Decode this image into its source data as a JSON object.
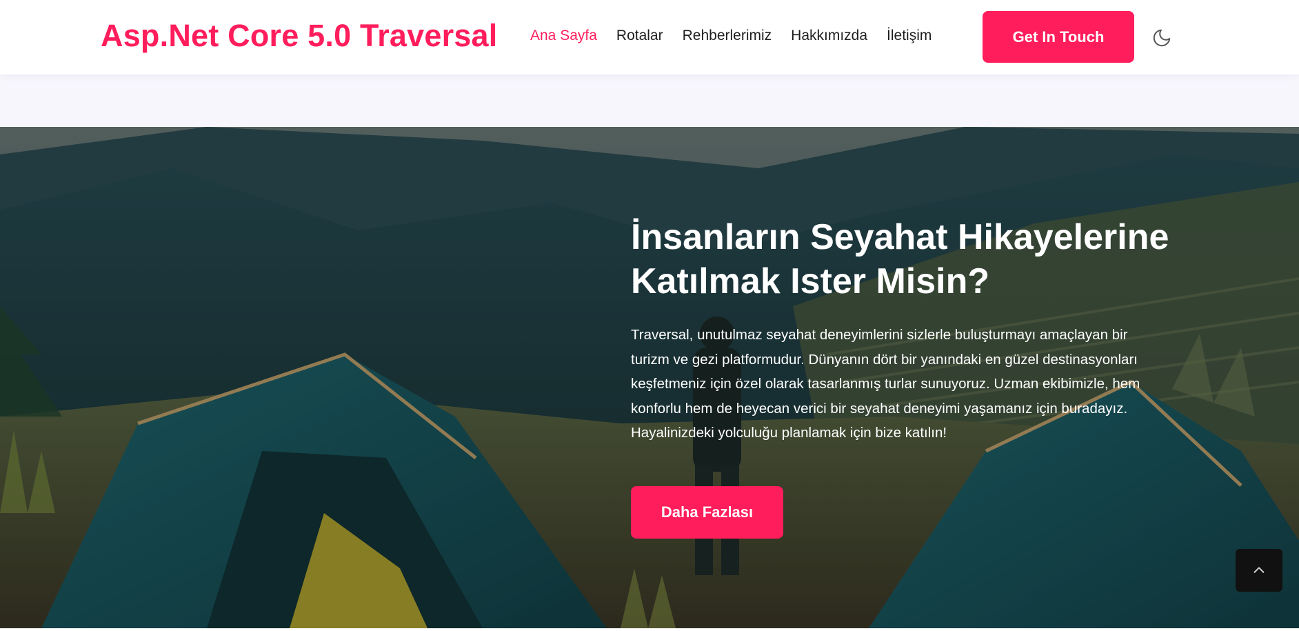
{
  "header": {
    "brand": "Asp.Net Core 5.0 Traversal",
    "nav": [
      {
        "label": "Ana Sayfa",
        "active": true
      },
      {
        "label": "Rotalar",
        "active": false
      },
      {
        "label": "Rehberlerimiz",
        "active": false
      },
      {
        "label": "Hakkımızda",
        "active": false
      },
      {
        "label": "İletişim",
        "active": false
      }
    ],
    "cta_label": "Get In Touch",
    "theme_icon": "moon-icon"
  },
  "hero": {
    "title_line1": "İnsanların Seyahat Hikayelerine",
    "title_line2": "Katılmak Ister Misin?",
    "text": "Traversal, unutulmaz seyahat deneyimlerini sizlerle buluşturmayı amaçlayan bir turizm ve gezi platformudur. Dünyanın dört bir yanındaki en güzel destinasyonları keşfetmeniz için özel olarak tasarlanmış turlar sunuyoruz. Uzman ekibimizle, hem konforlu hem de heyecan verici bir seyahat deneyimi yaşamanız için buradayız. Hayalinizdeki yolculuğu planlamak için bize katılın!",
    "button_label": "Daha Fazlası"
  },
  "scroll_top_icon": "chevron-up-icon",
  "colors": {
    "accent": "#ff1d5c",
    "band": "#f7f6fd",
    "text_dark": "#1f1f1f"
  }
}
